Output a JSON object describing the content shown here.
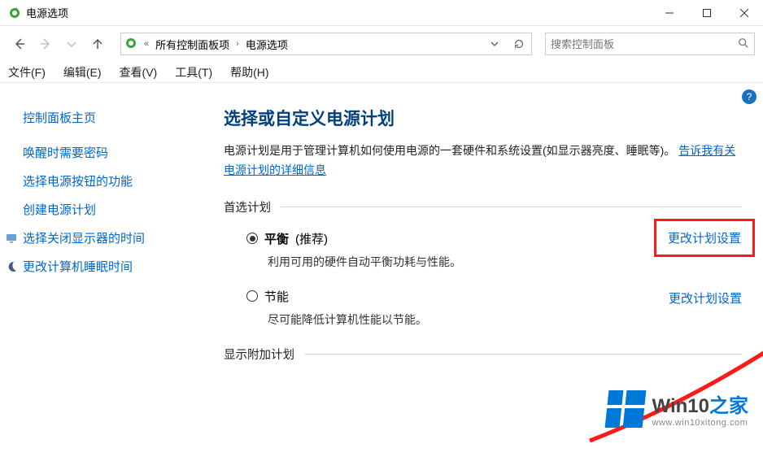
{
  "window": {
    "title": "电源选项"
  },
  "address": {
    "crumb1": "所有控制面板项",
    "crumb2": "电源选项"
  },
  "search": {
    "placeholder": "搜索控制面板"
  },
  "menu": {
    "file": "文件(F)",
    "edit": "编辑(E)",
    "view": "查看(V)",
    "tools": "工具(T)",
    "help": "帮助(H)"
  },
  "sidebar": {
    "home": "控制面板主页",
    "links": {
      "wake_password": "唤醒时需要密码",
      "power_button": "选择电源按钮的功能",
      "create_plan": "创建电源计划",
      "display_off": "选择关闭显示器的时间",
      "sleep_time": "更改计算机睡眠时间"
    }
  },
  "main": {
    "heading": "选择或自定义电源计划",
    "description_prefix": "电源计划是用于管理计算机如何使用电源的一套硬件和系统设置(如显示器亮度、睡眠等)。",
    "description_link": "告诉我有关电源计划的详细信息",
    "preferred_label": "首选计划",
    "additional_label": "显示附加计划",
    "plan_balanced": {
      "name": "平衡",
      "hint": "(推荐)",
      "desc": "利用可用的硬件自动平衡功耗与性能。",
      "change_link": "更改计划设置"
    },
    "plan_saver": {
      "name": "节能",
      "desc": "尽可能降低计算机性能以节能。",
      "change_link": "更改计划设置"
    }
  },
  "watermark": {
    "brand_prefix": "Win10",
    "brand_suffix": "之家",
    "url": "www.win10xitong.com"
  }
}
